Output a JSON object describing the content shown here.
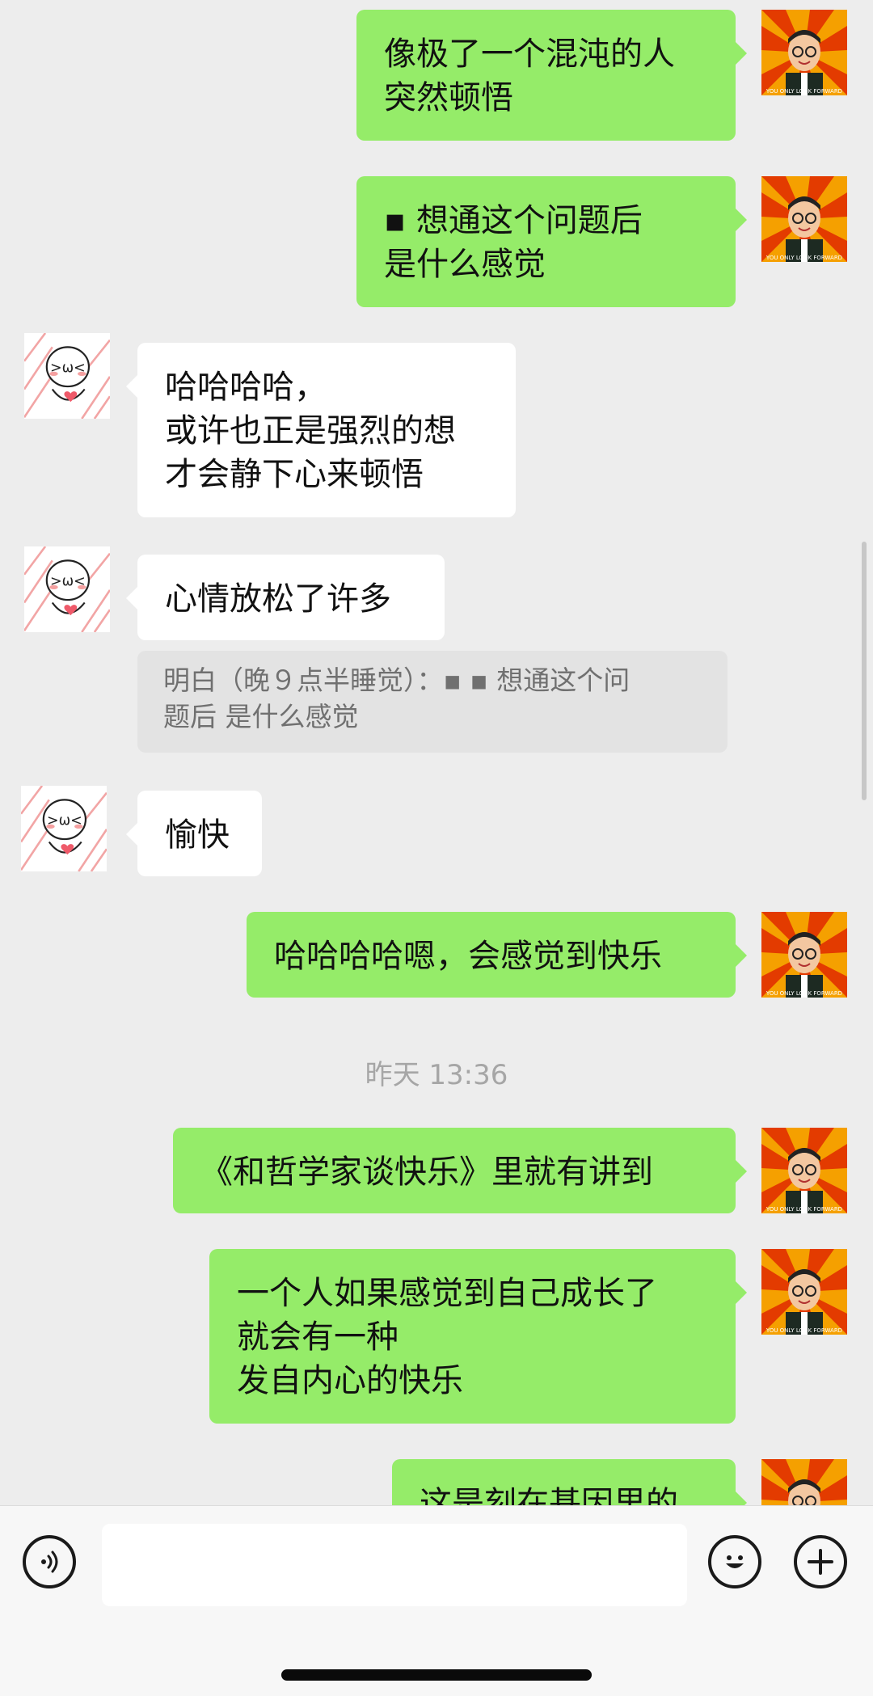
{
  "messages": [
    {
      "side": "out",
      "text": "像极了一个混沌的人\n突然顿悟"
    },
    {
      "side": "out",
      "text": "▪ 想通这个问题后\n是什么感觉"
    },
    {
      "side": "in",
      "text": "哈哈哈哈，\n或许也正是强烈的想\n才会静下心来顿悟"
    },
    {
      "side": "in",
      "text": "心情放松了许多"
    },
    {
      "side": "quote",
      "text": "明白（晚９点半睡觉）：▪ ▪ 想通这个问\n题后 是什么感觉"
    },
    {
      "side": "in",
      "text": "愉快"
    },
    {
      "side": "out",
      "text": "哈哈哈哈嗯，会感觉到快乐"
    },
    {
      "side": "time",
      "text": "昨天 13:36"
    },
    {
      "side": "out",
      "text": "《和哲学家谈快乐》里就有讲到"
    },
    {
      "side": "out",
      "text": "一个人如果感觉到自己成长了\n就会有一种\n发自内心的快乐"
    },
    {
      "side": "out",
      "text": "这是刻在基因里的"
    }
  ],
  "avatars": {
    "self_caption": "YOU ONLY LOOK FORWARD",
    "other_expression": ">ω<"
  },
  "input_bar": {
    "value": "",
    "voice_icon": "voice-icon",
    "emoji_icon": "emoji-icon",
    "plus_icon": "plus-icon"
  },
  "colors": {
    "outgoing_bubble": "#95ec69",
    "incoming_bubble": "#ffffff",
    "background": "#ededed",
    "quote_bg": "#e3e3e3"
  }
}
